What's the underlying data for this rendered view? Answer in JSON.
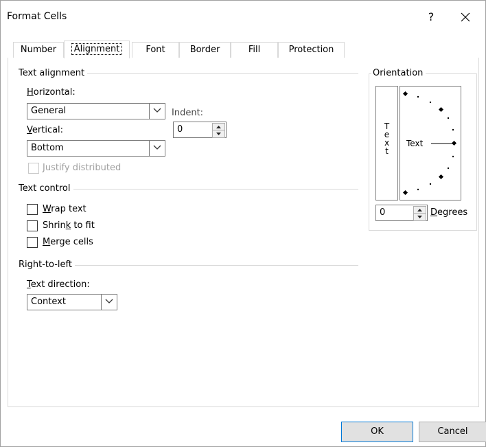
{
  "window": {
    "title": "Format Cells",
    "help_label": "?",
    "close_label": "✕"
  },
  "tabs": [
    "Number",
    "Alignment",
    "Font",
    "Border",
    "Fill",
    "Protection"
  ],
  "text_alignment": {
    "group_label": "Text alignment",
    "horizontal_label_u": "H",
    "horizontal_label_rest": "orizontal:",
    "horizontal_value": "General",
    "indent_label": "Indent:",
    "indent_value": "0",
    "vertical_label_u": "V",
    "vertical_label_rest": "ertical:",
    "vertical_value": "Bottom",
    "justify_label": "Justify distributed"
  },
  "text_control": {
    "group_label": "Text control",
    "wrap_u": "W",
    "wrap_rest": "rap text",
    "shrink_pre": "Shrin",
    "shrink_u": "k",
    "shrink_post": " to fit",
    "merge_u": "M",
    "merge_rest": "erge cells"
  },
  "rtl": {
    "group_label": "Right-to-left",
    "direction_u": "T",
    "direction_rest": "ext direction:",
    "direction_value": "Context"
  },
  "orientation": {
    "group_label": "Orientation",
    "vertical_text": [
      "T",
      "e",
      "x",
      "t"
    ],
    "dial_text": "Text",
    "degrees_value": "0",
    "degrees_u": "D",
    "degrees_rest": "egrees"
  },
  "footer": {
    "ok_label": "OK",
    "cancel_label": "Cancel"
  }
}
